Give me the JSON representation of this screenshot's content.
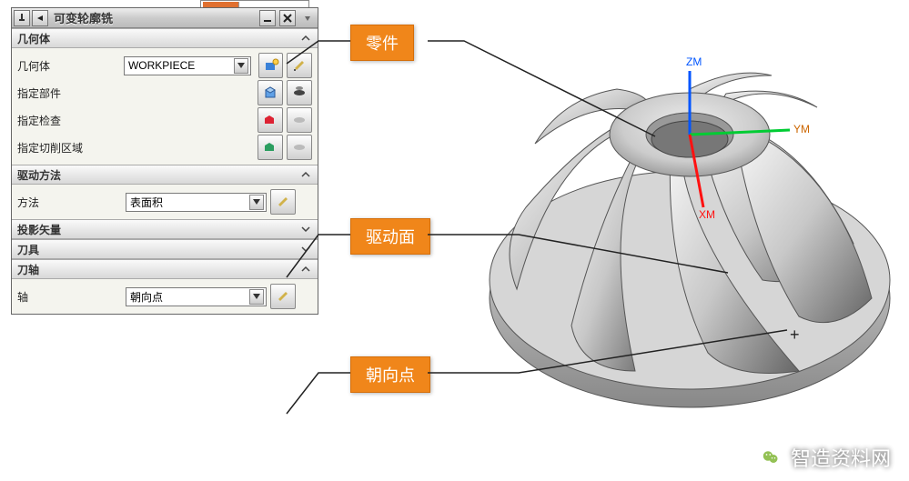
{
  "titlebar": {
    "title": "可变轮廓铣"
  },
  "sections": {
    "geometry": {
      "header": "几何体",
      "rows": {
        "body_label": "几何体",
        "body_value": "WORKPIECE",
        "part_label": "指定部件",
        "check_label": "指定检查",
        "cutarea_label": "指定切削区域"
      }
    },
    "drive": {
      "header": "驱动方法",
      "method_label": "方法",
      "method_value": "表面积"
    },
    "projection": {
      "header": "投影矢量"
    },
    "tool": {
      "header": "刀具"
    },
    "axis": {
      "header": "刀轴",
      "axis_label": "轴",
      "axis_value": "朝向点"
    }
  },
  "callouts": {
    "part": "零件",
    "drive_surface": "驱动面",
    "toward_point": "朝向点"
  },
  "viewport": {
    "axes": {
      "z": "ZM",
      "y": "YM",
      "x": "XM"
    },
    "crosshair": "+"
  },
  "watermark": {
    "text": "智造资料网"
  }
}
